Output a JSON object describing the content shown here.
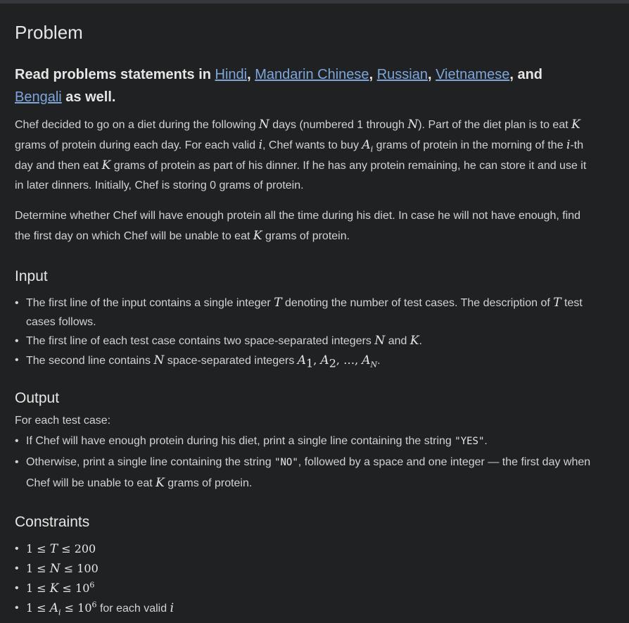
{
  "title": "Problem",
  "languages": {
    "prefix": "Read problems statements in ",
    "hindi": "Hindi",
    "mandarin": "Mandarin Chinese",
    "russian": "Russian",
    "vietnamese": "Vietnamese",
    "and": ", and",
    "bengali": "Bengali",
    "suffix": " as well."
  },
  "statement": {
    "p1_a": "Chef decided to go on a diet during the following ",
    "p1_b": " days (numbered 1 through ",
    "p1_c": "). Part of the diet plan is to eat ",
    "p1_d": "grams of protein during each day. For each valid ",
    "p1_e": ", Chef wants to buy ",
    "p1_f": " grams of protein in the morning of the ",
    "p1_g": "-th",
    "p1_h": "day and then eat ",
    "p1_i": " grams of protein as part of his dinner. If he has any protein remaining, he can store it and use it",
    "p1_j": "in later dinners. Initially, Chef is storing 0 grams of protein.",
    "p2_a": "Determine whether Chef will have enough protein all the time during his diet. In case he will not have enough, find",
    "p2_b": "the first day on which Chef will be unable to eat ",
    "p2_c": " grams of protein."
  },
  "input": {
    "heading": "Input",
    "li1_a": "The first line of the input contains a single integer ",
    "li1_b": " denoting the number of test cases. The description of ",
    "li1_c": " test",
    "li1_d": "cases follows.",
    "li2_a": "The first line of each test case contains two space-separated integers ",
    "li2_b": " and ",
    "li2_c": ".",
    "li3_a": "The second line contains ",
    "li3_b": " space-separated integers "
  },
  "output": {
    "heading": "Output",
    "intro": "For each test case:",
    "li1_a": "If Chef will have enough protein during his diet, print a single line containing the string ",
    "li1_code": "\"YES\"",
    "li1_b": ".",
    "li2_a": "Otherwise, print a single line containing the string ",
    "li2_code": "\"NO\"",
    "li2_b": ", followed by a space and one integer — the first day when",
    "li2_c": "Chef will be unable to eat ",
    "li2_d": " grams of protein."
  },
  "constraints": {
    "heading": "Constraints",
    "for_each_valid": " for each valid "
  },
  "math": {
    "N": "N",
    "K": "K",
    "i": "i",
    "T": "T",
    "A": "A",
    "one": "1",
    "le": " ≤ ",
    "two_hundred": "200",
    "hundred": "100",
    "ten": "10",
    "six": "6",
    "list_sep": ", ",
    "dots": "…",
    "period": ".",
    "sub1": "1",
    "sub2": "2"
  },
  "colors": {
    "background": "#202122",
    "text": "#d2d2d2",
    "link": "#7ea6da"
  }
}
